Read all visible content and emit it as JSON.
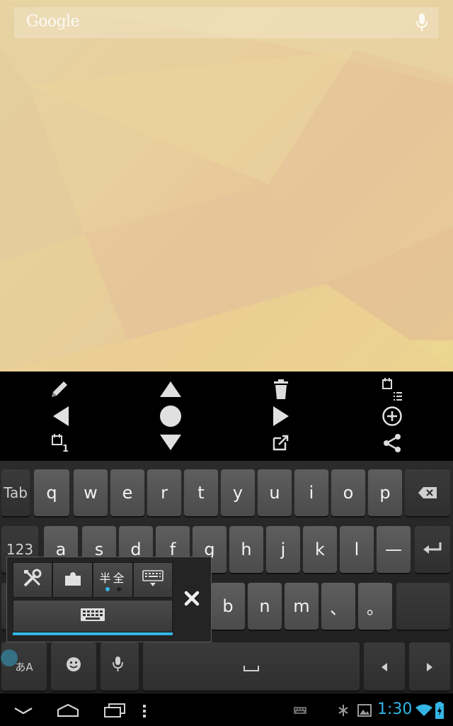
{
  "search": {
    "logo": "Google"
  },
  "keyboard": {
    "row1": [
      "q",
      "w",
      "e",
      "r",
      "t",
      "y",
      "u",
      "i",
      "o",
      "p"
    ],
    "tab_label": "Tab",
    "row2_left": "123",
    "row2_visible": [
      "a",
      "s",
      "d",
      "f",
      "g",
      "h",
      "j",
      "k",
      "l",
      "—"
    ],
    "row3_visible": [
      "b",
      "n",
      "m",
      "、",
      "。"
    ]
  },
  "popup": {
    "width_toggle_label": "半全"
  },
  "ime_label": "あA",
  "status": {
    "time": "1:30"
  },
  "colors": {
    "accent": "#33b5e5"
  }
}
